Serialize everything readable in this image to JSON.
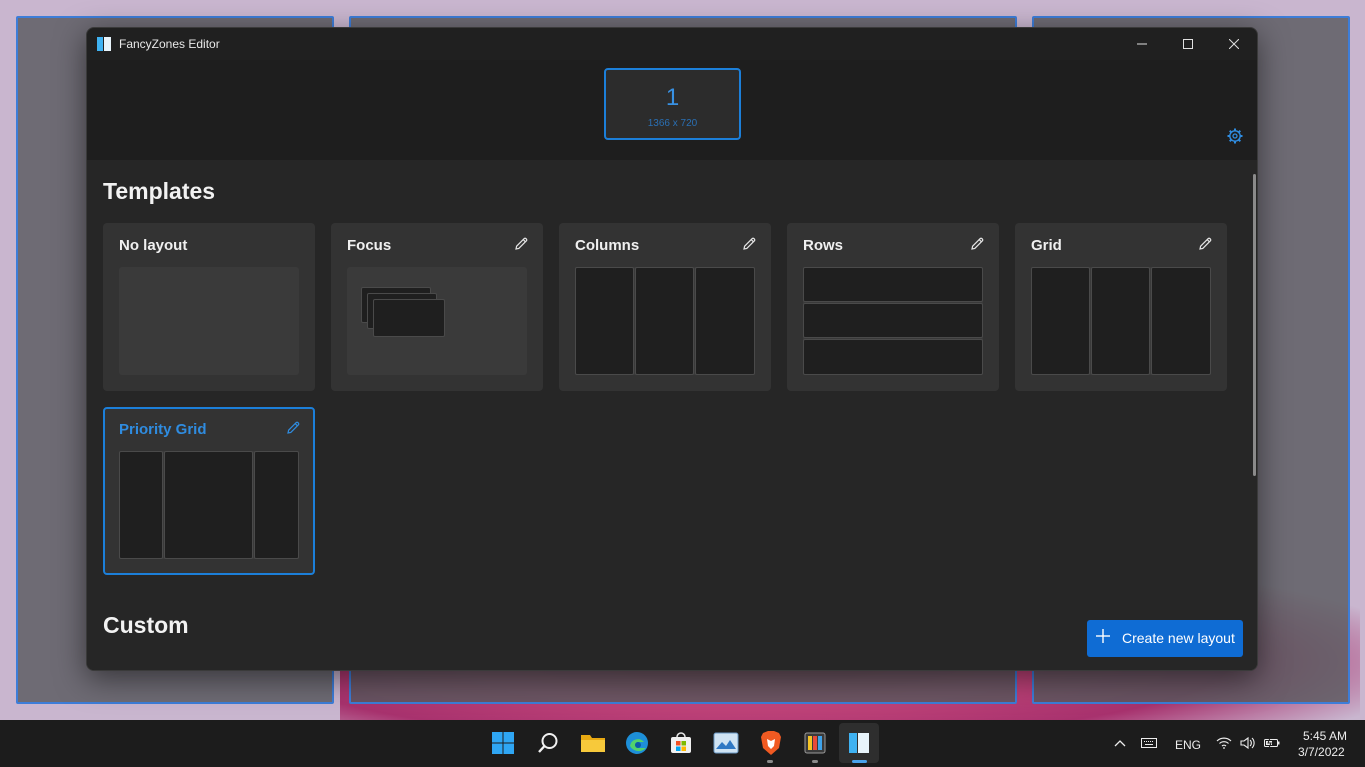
{
  "window": {
    "title": "FancyZones Editor"
  },
  "monitor": {
    "number": "1",
    "resolution": "1366 x 720"
  },
  "sections": {
    "templates": "Templates",
    "custom": "Custom"
  },
  "templates": [
    {
      "name": "No layout",
      "editable": false,
      "selected": false
    },
    {
      "name": "Focus",
      "editable": true,
      "selected": false
    },
    {
      "name": "Columns",
      "editable": true,
      "selected": false
    },
    {
      "name": "Rows",
      "editable": true,
      "selected": false
    },
    {
      "name": "Grid",
      "editable": true,
      "selected": false
    },
    {
      "name": "Priority Grid",
      "editable": true,
      "selected": true
    }
  ],
  "actions": {
    "create_layout": "Create new layout"
  },
  "taskbar": {
    "apps": [
      "start-icon",
      "search-icon",
      "file-explorer-icon",
      "edge-icon",
      "store-icon",
      "photos-icon",
      "brave-icon",
      "powertoys-icon",
      "fancyzones-icon"
    ],
    "language": "ENG",
    "time": "5:45 AM",
    "date": "3/7/2022"
  },
  "colors": {
    "accent": "#1c7fd9",
    "window_bg": "#202020",
    "card_bg": "#333333"
  }
}
